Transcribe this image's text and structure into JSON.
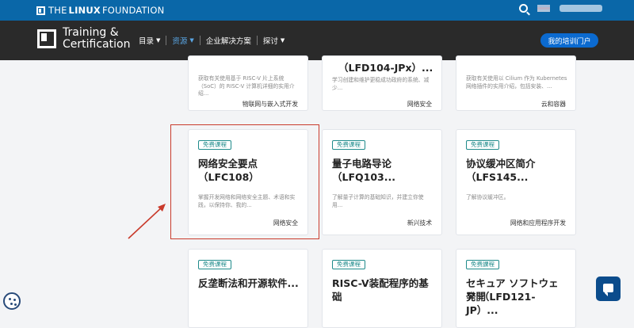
{
  "topbar": {
    "logo_text_the": "THE",
    "logo_text_linux": "LINUX",
    "logo_text_foundation": "FOUNDATION"
  },
  "navbar": {
    "brand_line1": "Training &",
    "brand_line2": "Certification",
    "items": [
      {
        "label": "目录"
      },
      {
        "label": "资源"
      },
      {
        "label": "企业解决方案"
      },
      {
        "label": "探讨"
      }
    ],
    "portal_button": "我的培训门户"
  },
  "cards": {
    "top_left": {
      "desc": "获取有关使用基于 RISC-V 片上系统（SoC）的 RISC-V 计算机详细的实用介绍...",
      "tag": "物联网与嵌入式开发"
    },
    "top_mid": {
      "title": "（LFD104-JPx）...",
      "desc": "学习创建和维护更稳成功政府的系统、减少...",
      "tag": "网络安全"
    },
    "top_right": {
      "desc": "获取有关使用以 Cilium 作为 Kubernetes 网络插件的实用介绍，包括安装、...",
      "tag": "云和容器"
    },
    "mid_left": {
      "badge": "免费课程",
      "title_line1": "网络安全要点",
      "title_line2": "（LFC108）",
      "desc": "掌握开发网络和网络安全主题、术语和实践，以保持你、我的...",
      "tag": "网络安全"
    },
    "mid_mid": {
      "badge": "免费课程",
      "title_line1": "量子电路导论（LFQ103...",
      "desc": "了解量子计算的基础知识，并建立你使用...",
      "tag": "新兴技术"
    },
    "mid_right": {
      "badge": "免费课程",
      "title_line1": "协议缓冲区简介",
      "title_line2": "（LFS145...",
      "desc": "了解协议缓冲区。",
      "tag": "网络和应用程序开发"
    },
    "bot_left": {
      "badge": "免费课程",
      "title_line1": "反垄断法和开源软件..."
    },
    "bot_mid": {
      "badge": "免费课程",
      "title_line1": "RISC-V装配程序的基础"
    },
    "bot_right": {
      "badge": "免费課程",
      "title_line1": "セキュア ソフトウェア開",
      "title_line2": "発 （LFD121-JP）..."
    }
  },
  "colors": {
    "topbar": "#0a67a8",
    "navbar": "#2a2a2a",
    "accent": "#0b6ad0",
    "badge": "#1f8b8b",
    "highlight": "#c93b2c"
  }
}
